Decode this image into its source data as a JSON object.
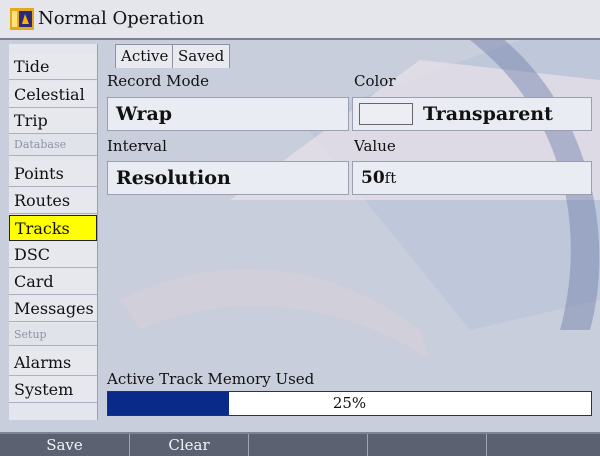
{
  "window": {
    "title": "Normal Operation"
  },
  "sidebar": {
    "items": [
      {
        "label": "Tide"
      },
      {
        "label": "Celestial"
      },
      {
        "label": "Trip"
      },
      {
        "header": "Database"
      },
      {
        "label": "Points"
      },
      {
        "label": "Routes"
      },
      {
        "label": "Tracks",
        "selected": true
      },
      {
        "label": "DSC"
      },
      {
        "label": "Card"
      },
      {
        "label": "Messages"
      },
      {
        "header": "Setup"
      },
      {
        "label": "Alarms"
      },
      {
        "label": "System"
      }
    ]
  },
  "tabs": [
    {
      "label": "Active",
      "selected": true
    },
    {
      "label": "Saved"
    }
  ],
  "settings": {
    "record_mode_label": "Record Mode",
    "record_mode_value": "Wrap",
    "color_label": "Color",
    "color_value": "Transparent",
    "interval_label": "Interval",
    "interval_value": "Resolution",
    "value_label": "Value",
    "value_value": "50",
    "value_unit": "ft"
  },
  "memory": {
    "label": "Active Track Memory Used",
    "percent": 25,
    "percent_text": "25%"
  },
  "softkeys": [
    {
      "label": "Save"
    },
    {
      "label": "Clear"
    },
    {
      "label": ""
    },
    {
      "label": ""
    },
    {
      "label": ""
    }
  ],
  "colors": {
    "selected_item": "#ffff00",
    "progress_fill": "#0a2a8a",
    "background": "#c8cedc"
  }
}
